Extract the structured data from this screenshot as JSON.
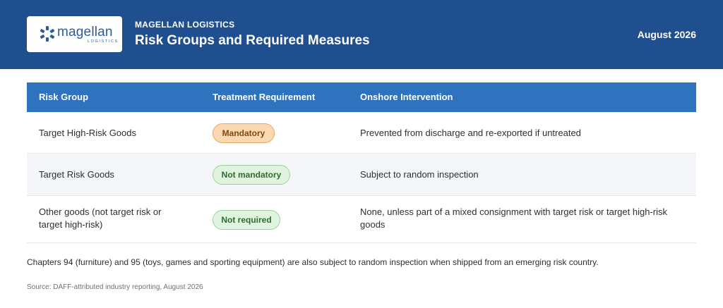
{
  "header": {
    "logo_word": "magellan",
    "logo_sub": "LOGISTICS",
    "company": "MAGELLAN LOGISTICS",
    "title": "Risk Groups and Required Measures",
    "date": "August 2026"
  },
  "colors": {
    "header_bg": "#1f4f8f",
    "table_header_bg": "#2f72bd",
    "mandatory_badge": "#fbd8b0",
    "green_badge": "#dff3df"
  },
  "table": {
    "columns": [
      "Risk Group",
      "Treatment Requirement",
      "Onshore Intervention"
    ],
    "rows": [
      {
        "risk_group": "Target High-Risk Goods",
        "treatment": "Mandatory",
        "intervention": "Prevented from discharge and re-exported if untreated"
      },
      {
        "risk_group": "Target Risk Goods",
        "treatment": "Not mandatory",
        "intervention": "Subject to random inspection"
      },
      {
        "risk_group": "Other goods (not target risk or target high-risk)",
        "treatment": "Not required",
        "intervention": "None, unless part of a mixed consignment with target risk or target high-risk goods"
      }
    ]
  },
  "note": "Chapters 94 (furniture) and 95 (toys, games and sporting equipment) are also subject to random inspection when shipped from an emerging risk country.",
  "source": "Source: DAFF-attributed industry reporting, August 2026"
}
